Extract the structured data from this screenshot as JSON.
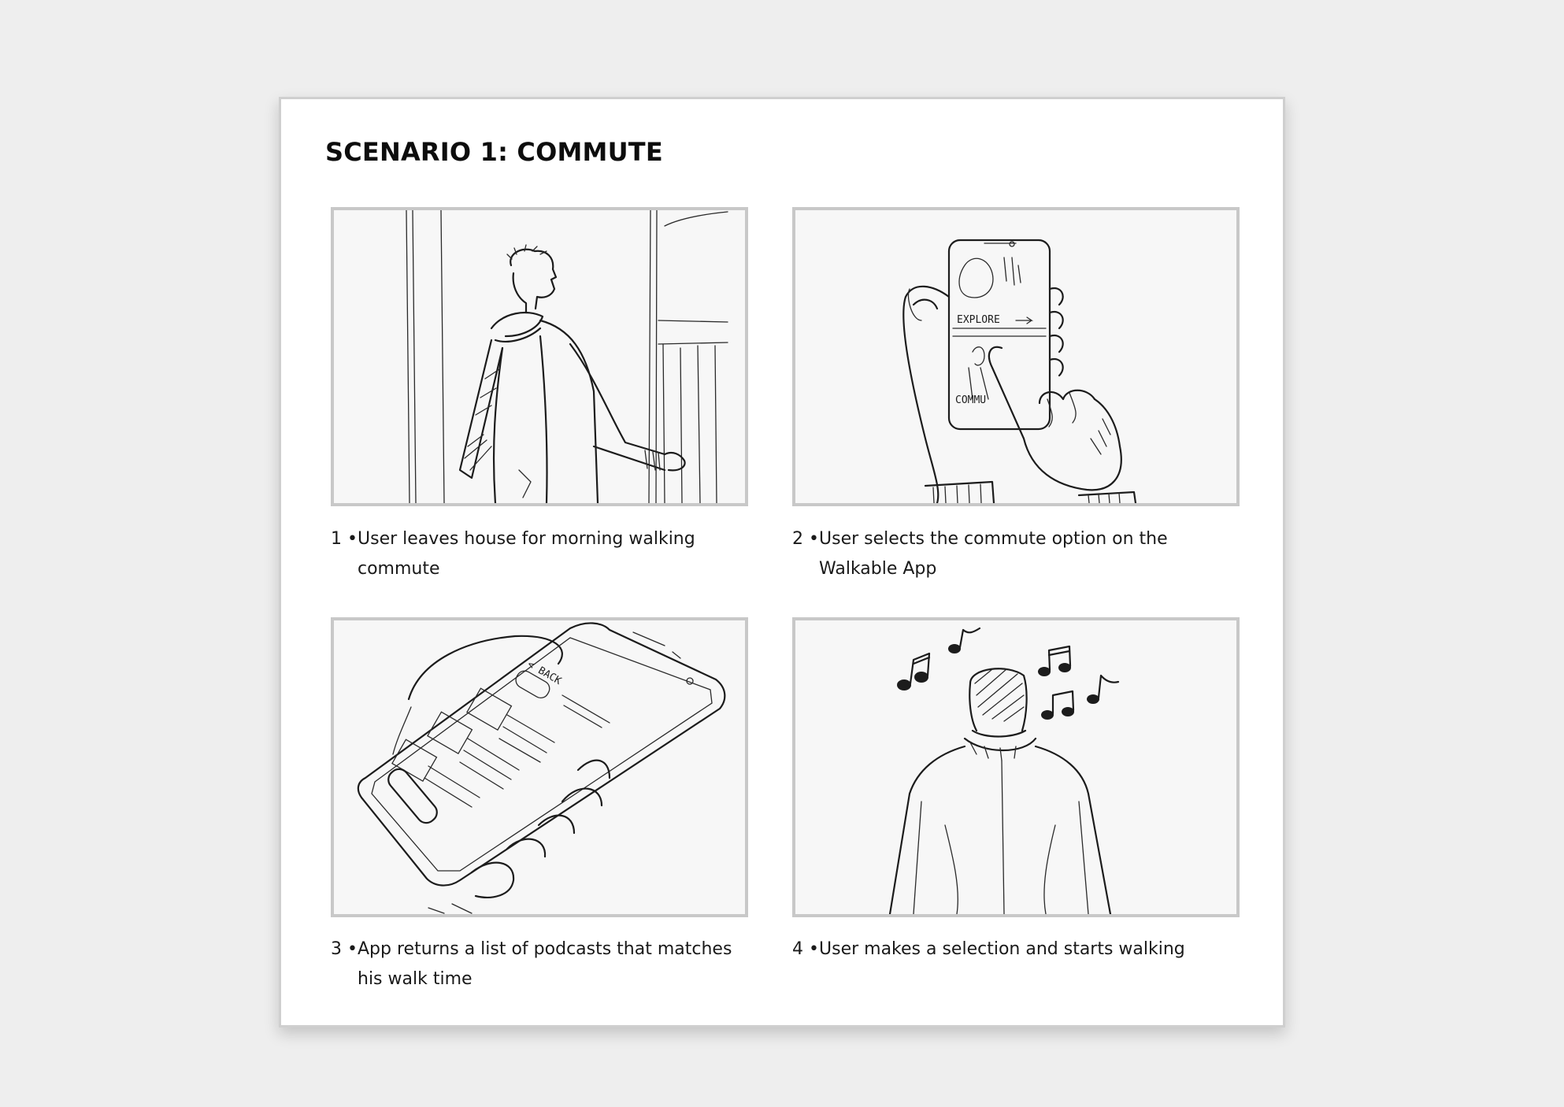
{
  "title": "SCENARIO 1: COMMUTE",
  "panels": [
    {
      "number": "1 •",
      "caption": "User leaves house for morning walking commute",
      "illustration": "man-leaving-house-sketch"
    },
    {
      "number": "2 •",
      "caption": "User selects the commute option on the Walkable App",
      "illustration": "hand-holding-phone-sketch",
      "sketch_labels": [
        "EXPLORE",
        "COMMU"
      ]
    },
    {
      "number": "3 •",
      "caption": "App returns a list of podcasts that matches his walk time",
      "illustration": "phone-podcast-list-sketch",
      "sketch_labels": [
        "< BACK"
      ]
    },
    {
      "number": "4 •",
      "caption": "User makes a selection and starts walking",
      "illustration": "man-walking-with-music-sketch"
    }
  ]
}
